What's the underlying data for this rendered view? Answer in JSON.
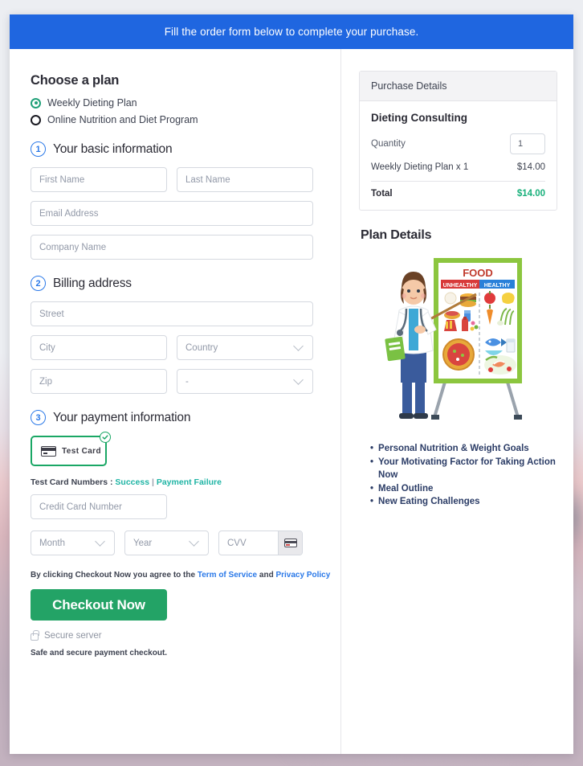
{
  "banner": {
    "text": "Fill the order form below to complete your purchase."
  },
  "plan": {
    "heading": "Choose a plan",
    "options": [
      {
        "label": "Weekly Dieting Plan",
        "selected": true
      },
      {
        "label": "Online Nutrition and Diet Program",
        "selected": false
      }
    ]
  },
  "step1": {
    "number": "1",
    "title": "Your basic information",
    "fields": {
      "first_name": "First Name",
      "last_name": "Last Name",
      "email": "Email Address",
      "company": "Company Name"
    }
  },
  "step2": {
    "number": "2",
    "title": "Billing address",
    "fields": {
      "street": "Street",
      "city": "City",
      "country": "Country",
      "zip": "Zip",
      "state": "-"
    }
  },
  "step3": {
    "number": "3",
    "title": "Your payment information",
    "method": {
      "label": "Test Card",
      "selected": true
    },
    "test_cards": {
      "prefix": "Test Card Numbers :",
      "success": "Success",
      "separator": "|",
      "failure": "Payment Failure"
    },
    "fields": {
      "credit_card": "Credit Card Number",
      "month": "Month",
      "year": "Year",
      "cvv": "CVV"
    }
  },
  "footer": {
    "terms_prefix": "By clicking Checkout Now you agree to the",
    "terms_link": "Term of Service",
    "terms_and": "and",
    "privacy_link": "Privacy Policy",
    "checkout_label": "Checkout Now",
    "secure_server": "Secure server",
    "safe_note": "Safe and secure payment checkout."
  },
  "purchase": {
    "header": "Purchase Details",
    "product": "Dieting Consulting",
    "quantity_label": "Quantity",
    "quantity_value": "1",
    "line_item": "Weekly Dieting Plan x 1",
    "line_amount": "$14.00",
    "total_label": "Total",
    "total_amount": "$14.00"
  },
  "plan_details": {
    "title": "Plan Details",
    "illustration": {
      "alt": "nutritionist-pointing-at-food-chart",
      "board_title": "FOOD",
      "column_unhealthy": "UNHEALTHY",
      "column_healthy": "HEALTHY"
    },
    "bullets": [
      "Personal Nutrition & Weight Goals",
      "Your Motivating Factor for Taking Action Now",
      "Meal Outline",
      "New Eating Challenges"
    ]
  },
  "colors": {
    "banner_blue": "#1f66e0",
    "accent_green": "#23a366",
    "total_green": "#18b07b",
    "link_blue": "#2b79e8",
    "link_teal": "#1eb4a4"
  }
}
